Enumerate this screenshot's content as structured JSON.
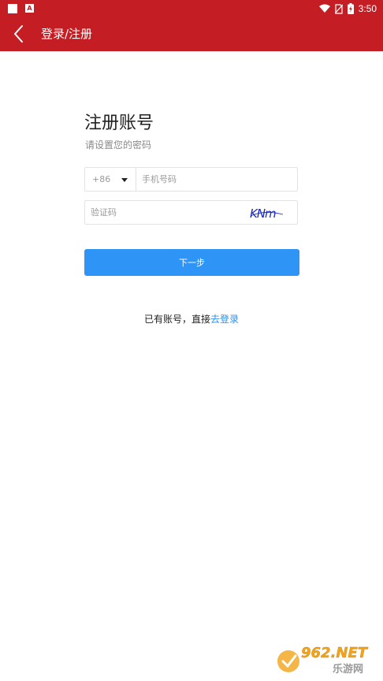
{
  "status_bar": {
    "time": "3:50",
    "icons": [
      "notification-square-icon",
      "notification-a-icon",
      "wifi-icon",
      "no-sim-icon",
      "battery-charging-icon"
    ],
    "a_glyph": "A"
  },
  "app_bar": {
    "title": "登录/注册",
    "back_icon": "chevron-left-icon",
    "background_color": "#c51d24"
  },
  "form": {
    "heading": "注册账号",
    "subheading": "请设置您的密码",
    "country_code": "+86",
    "phone_placeholder": "手机号码",
    "code_placeholder": "验证码",
    "captcha_text": "KNm",
    "next_button": "下一步",
    "button_color": "#2e94f5"
  },
  "footer": {
    "hint_text": "已有账号，直接",
    "login_link": "去登录",
    "link_color": "#2e8fe8"
  },
  "watermark": {
    "logo_text": "962.NET",
    "logo_subtext": "乐游网"
  }
}
